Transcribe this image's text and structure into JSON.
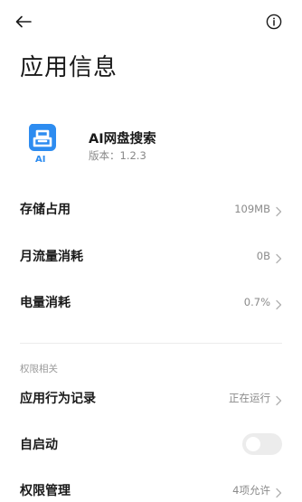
{
  "header": {
    "back_icon": "arrow-left-icon",
    "info_icon": "info-circle-icon",
    "title": "应用信息"
  },
  "app": {
    "name": "AI网盘搜索",
    "version_label": "版本：",
    "version": "1.2.3",
    "icon": "ai-cloud-drive-search-logo",
    "icon_color": "#2d8cf0"
  },
  "info_rows": [
    {
      "label": "存储占用",
      "value": "109MB"
    },
    {
      "label": "月流量消耗",
      "value": "0B"
    },
    {
      "label": "电量消耗",
      "value": "0.7%"
    }
  ],
  "permissions": {
    "section_label": "权限相关",
    "rows": [
      {
        "label": "应用行为记录",
        "value": "正在运行"
      },
      {
        "label": "自启动",
        "value": "",
        "toggle": false
      },
      {
        "label": "权限管理",
        "value": "4项允许"
      }
    ]
  }
}
